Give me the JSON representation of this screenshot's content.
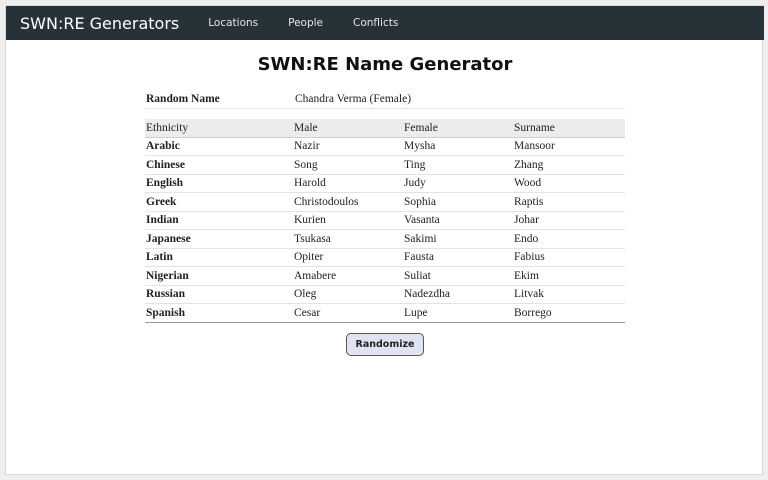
{
  "navbar": {
    "brand": "SWN:RE Generators",
    "links": [
      "Locations",
      "People",
      "Conflicts"
    ]
  },
  "page": {
    "title": "SWN:RE Name Generator"
  },
  "random": {
    "label": "Random Name",
    "value": "Chandra Verma (Female)"
  },
  "table": {
    "headers": [
      "Ethnicity",
      "Male",
      "Female",
      "Surname"
    ],
    "rows": [
      [
        "Arabic",
        "Nazir",
        "Mysha",
        "Mansoor"
      ],
      [
        "Chinese",
        "Song",
        "Ting",
        "Zhang"
      ],
      [
        "English",
        "Harold",
        "Judy",
        "Wood"
      ],
      [
        "Greek",
        "Christodoulos",
        "Sophia",
        "Raptis"
      ],
      [
        "Indian",
        "Kurien",
        "Vasanta",
        "Johar"
      ],
      [
        "Japanese",
        "Tsukasa",
        "Sakimi",
        "Endo"
      ],
      [
        "Latin",
        "Opiter",
        "Fausta",
        "Fabius"
      ],
      [
        "Nigerian",
        "Amabere",
        "Suliat",
        "Ekim"
      ],
      [
        "Russian",
        "Oleg",
        "Nadezdha",
        "Litvak"
      ],
      [
        "Spanish",
        "Cesar",
        "Lupe",
        "Borrego"
      ]
    ]
  },
  "actions": {
    "randomize_label": "Randomize"
  }
}
